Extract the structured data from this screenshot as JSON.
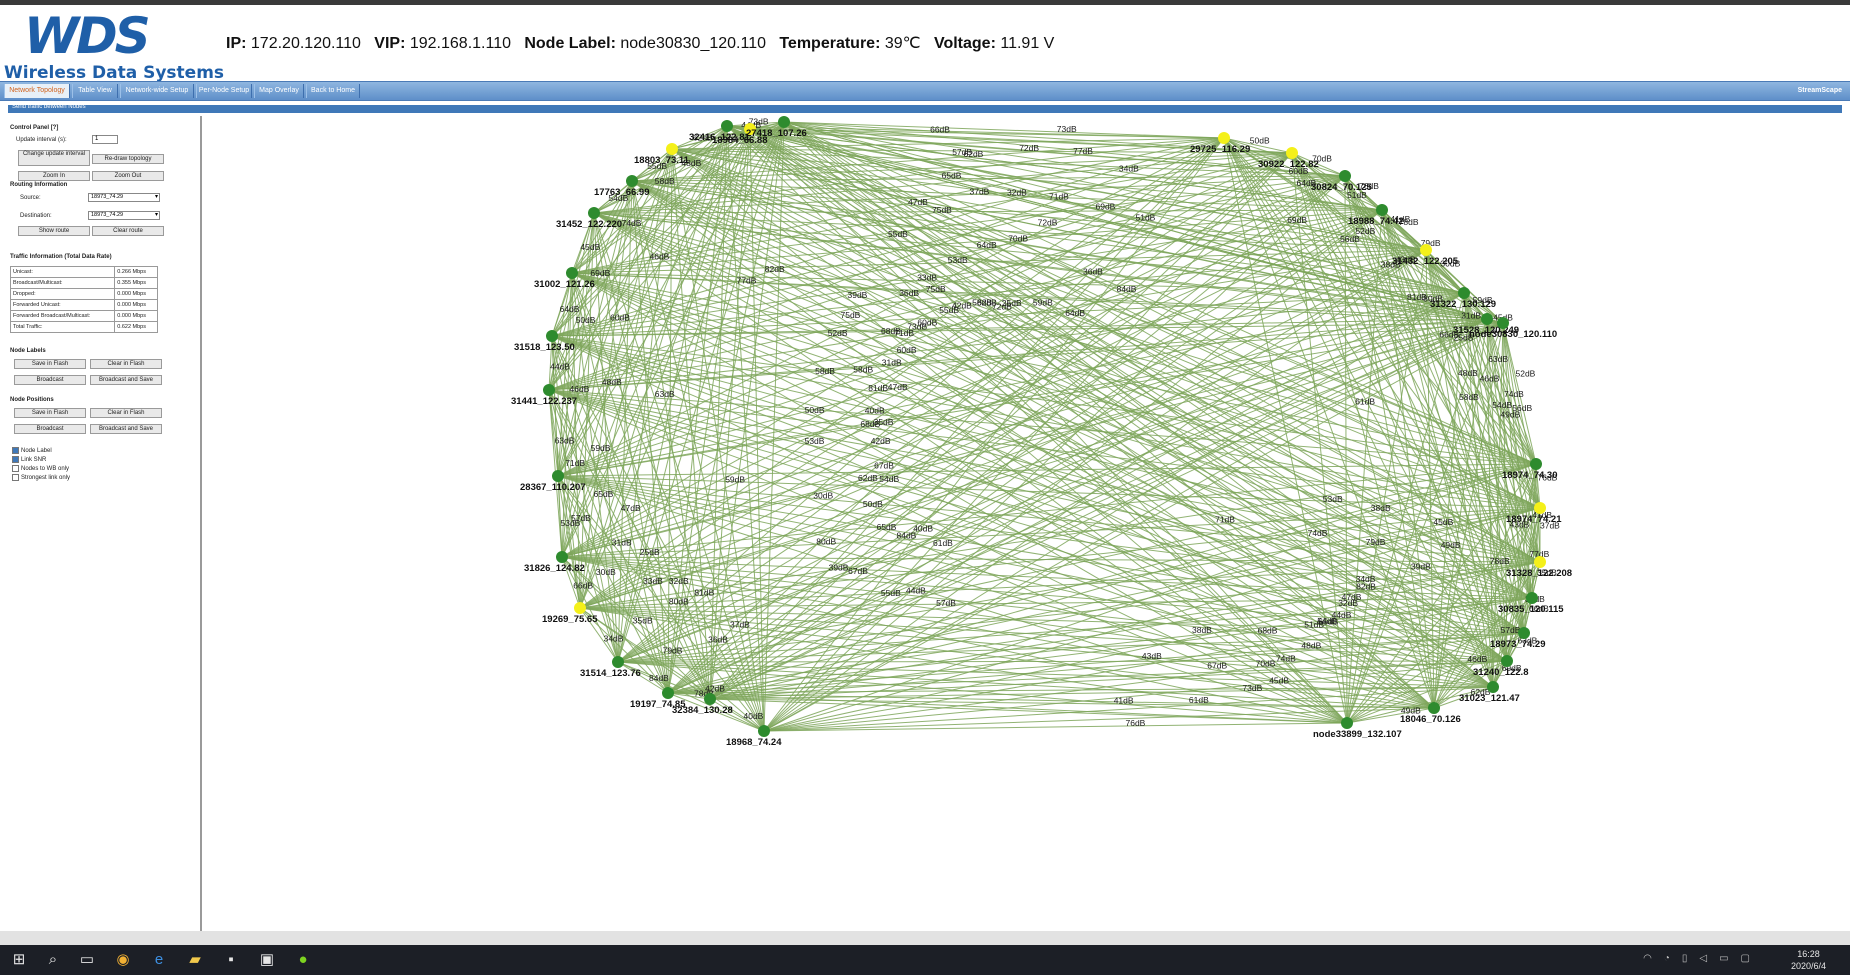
{
  "app": {
    "logo_mark": "WDS",
    "logo_text": "Wireless Data Systems",
    "status": {
      "ip_label": "IP:",
      "ip": "172.20.120.110",
      "vip_label": "VIP:",
      "vip": "192.168.1.110",
      "node_label_label": "Node Label:",
      "node_label": "node30830_120.110",
      "temperature_label": "Temperature:",
      "temperature": "39℃",
      "voltage_label": "Voltage:",
      "voltage": "11.91 V"
    }
  },
  "nav": {
    "tabs": [
      {
        "label": "Network Topology",
        "active": true
      },
      {
        "label": "Table View"
      },
      {
        "label": "Network-wide Setup"
      },
      {
        "label": "Per-Node Setup"
      },
      {
        "label": "Map Overlay"
      },
      {
        "label": "Back to Home"
      }
    ],
    "brand": "StreamScape"
  },
  "subbar": "Send traffic between Nodes",
  "sidebar": {
    "control_panel": "Control Panel",
    "control_help": "[?]",
    "update_interval_label": "Update interval (s):",
    "update_interval_value": "1",
    "change_interval": "Change update interval",
    "redraw": "Re-draw topology",
    "zoom_in": "Zoom In",
    "zoom_out": "Zoom Out",
    "routing_info": "Routing Information",
    "source_label": "Source:",
    "source_value": "18973_74.29",
    "destination_label": "Destination:",
    "destination_value": "18973_74.29",
    "show_route": "Show route",
    "clear_route": "Clear route",
    "traffic_info": "Traffic Information (Total Data Rate)",
    "traffic": [
      {
        "label": "Unicast:",
        "value": "0.266 Mbps"
      },
      {
        "label": "Broadcast/Multicast:",
        "value": "0.355 Mbps"
      },
      {
        "label": "Dropped:",
        "value": "0.000 Mbps"
      },
      {
        "label": "Forwarded Unicast:",
        "value": "0.000 Mbps"
      },
      {
        "label": "Forwarded Broadcast/Multicast:",
        "value": "0.000 Mbps"
      },
      {
        "label": "Total Traffic:",
        "value": "0.622 Mbps"
      }
    ],
    "node_labels": "Node Labels",
    "nl_save": "Save in Flash",
    "nl_clear": "Clear in Flash",
    "nl_broadcast": "Broadcast",
    "nl_broadcast_save": "Broadcast and Save",
    "node_positions": "Node Positions",
    "np_save": "Save in Flash",
    "np_clear": "Clear in Flash",
    "np_broadcast": "Broadcast",
    "np_broadcast_save": "Broadcast and Save",
    "checks": [
      {
        "label": "Node Label",
        "checked": true
      },
      {
        "label": "Link SNR",
        "checked": true
      },
      {
        "label": "Nodes to WB only",
        "checked": false
      },
      {
        "label": "Strongest link only",
        "checked": false
      }
    ]
  },
  "topology": {
    "link_color": "#7ea65a",
    "node_color": "#2e8b2e",
    "highlight_color": "#f4f01a",
    "nodes": [
      {
        "label": "18984_66.88",
        "highlight": true
      },
      {
        "label": "29725_116.29",
        "highlight": true
      },
      {
        "label": "30922_122.82",
        "highlight": true
      },
      {
        "label": "30824_70.125"
      },
      {
        "label": "18988_74.42"
      },
      {
        "label": "31432_122.205",
        "highlight": true
      },
      {
        "label": "31322_130.129"
      },
      {
        "label": "31528_120.249"
      },
      {
        "label": "node30830_120.110"
      },
      {
        "label": "18974_74.30"
      },
      {
        "label": "18974_74.21",
        "highlight": true
      },
      {
        "label": "31328_122.208",
        "highlight": true
      },
      {
        "label": "30835_120.115"
      },
      {
        "label": "18973_74.29"
      },
      {
        "label": "31240_122.8"
      },
      {
        "label": "31023_121.47"
      },
      {
        "label": "18046_70.126"
      },
      {
        "label": "node33899_132.107"
      },
      {
        "label": "18968_74.24"
      },
      {
        "label": "32384_130.28"
      },
      {
        "label": "19197_74.85"
      },
      {
        "label": "31514_123.76"
      },
      {
        "label": "19269_75.65",
        "highlight": true
      },
      {
        "label": "31826_124.82"
      },
      {
        "label": "28367_110.207"
      },
      {
        "label": "31441_122.237"
      },
      {
        "label": "31518_123.50"
      },
      {
        "label": "31002_121.26"
      },
      {
        "label": "31452_122.220"
      },
      {
        "label": "17763_66.99"
      },
      {
        "label": "18803_73.11",
        "highlight": true
      },
      {
        "label": "32416_122.81"
      },
      {
        "label": "27418_107.26"
      }
    ],
    "db_labels": [
      "66dB",
      "57dB",
      "65dB",
      "47dB",
      "53dB",
      "71dB",
      "59dB",
      "63dB",
      "46dB",
      "48dB",
      "44dB",
      "50dB",
      "60dB",
      "64dB",
      "69dB",
      "45dB",
      "74dB",
      "54dB",
      "58dB",
      "55dB",
      "62dB",
      "73dB",
      "70dB",
      "51dB",
      "52dB",
      "56dB",
      "49dB",
      "61dB",
      "67dB",
      "68dB",
      "75dB",
      "72dB",
      "76dB",
      "41dB",
      "43dB",
      "38dB",
      "39dB",
      "40dB",
      "42dB",
      "36dB",
      "37dB",
      "77dB",
      "78dB",
      "79dB",
      "80dB",
      "81dB",
      "82dB",
      "84dB",
      "35dB",
      "33dB",
      "32dB",
      "34dB",
      "30dB",
      "31dB",
      "25dB"
    ]
  },
  "taskbar": {
    "time": "16:28",
    "date": "2020/6/4"
  }
}
